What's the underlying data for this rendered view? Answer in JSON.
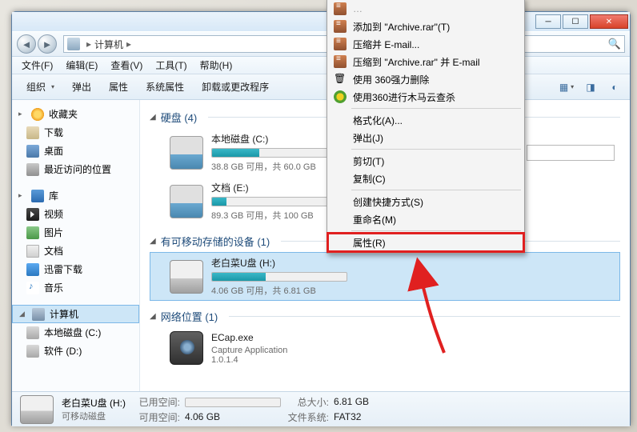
{
  "window": {
    "min": "─",
    "max": "☐",
    "close": "✕"
  },
  "address": {
    "root": "计算机",
    "sep": "▸"
  },
  "search": {
    "placeholder": ""
  },
  "menu": {
    "file": "文件(F)",
    "edit": "编辑(E)",
    "view": "查看(V)",
    "tools": "工具(T)",
    "help": "帮助(H)"
  },
  "toolbar": {
    "organize": "组织",
    "eject": "弹出",
    "properties": "属性",
    "sysprops": "系统属性",
    "uninstall": "卸载或更改程序"
  },
  "sidebar": {
    "favorites": "收藏夹",
    "favs": {
      "downloads": "下载",
      "desktop": "桌面",
      "recent": "最近访问的位置"
    },
    "libraries": "库",
    "libs": {
      "videos": "视频",
      "pictures": "图片",
      "documents": "文档",
      "xunlei": "迅雷下载",
      "music": "音乐"
    },
    "computer": "计算机",
    "drives": {
      "c": "本地磁盘 (C:)",
      "d": "软件 (D:)"
    }
  },
  "content": {
    "hdd_section": "硬盘 (4)",
    "c": {
      "name": "本地磁盘 (C:)",
      "stat": "38.8 GB 可用，共 60.0 GB",
      "pct": 35
    },
    "e": {
      "name": "文档 (E:)",
      "stat": "89.3 GB 可用，共 100 GB",
      "pct": 11
    },
    "removable_section": "有可移动存储的设备 (1)",
    "h": {
      "name": "老白菜U盘 (H:)",
      "stat": "4.06 GB 可用，共 6.81 GB",
      "pct": 40
    },
    "network_section": "网络位置 (1)",
    "ecap": {
      "name": "ECap.exe",
      "sub1": "Capture Application",
      "sub2": "1.0.1.4"
    }
  },
  "status": {
    "title": "老白菜U盘 (H:)",
    "type": "可移动磁盘",
    "used_lbl": "已用空间:",
    "free_lbl": "可用空间:",
    "free_val": "4.06 GB",
    "size_lbl": "总大小:",
    "size_val": "6.81 GB",
    "fs_lbl": "文件系统:",
    "fs_val": "FAT32"
  },
  "ctx": {
    "addrar": "添加到 \"Archive.rar\"(T)",
    "email": "压缩并 E-mail...",
    "addrar_email": "压缩到 \"Archive.rar\" 并 E-mail",
    "force_del": "使用 360强力删除",
    "trojan": "使用360进行木马云查杀",
    "format": "格式化(A)...",
    "eject": "弹出(J)",
    "cut": "剪切(T)",
    "copy": "复制(C)",
    "shortcut": "创建快捷方式(S)",
    "rename": "重命名(M)",
    "props": "属性(R)"
  }
}
